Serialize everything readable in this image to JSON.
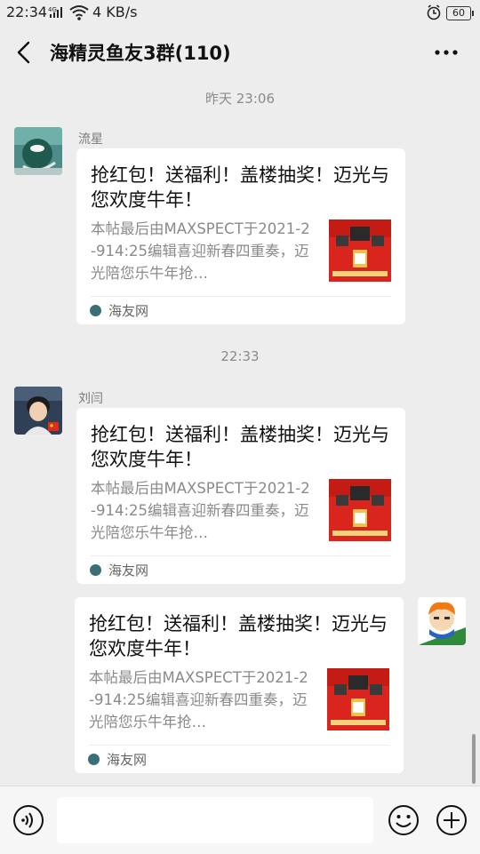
{
  "status_bar": {
    "time": "22:34",
    "signal_label": "4G",
    "speed": "4 KB/s",
    "battery": "60"
  },
  "header": {
    "title": "海精灵鱼友3群(110)"
  },
  "messages": [
    {
      "timestamp": "昨天 23:06",
      "sender": "流星",
      "card": {
        "title": "抢红包！送福利！盖楼抽奖！迈光与您欢度牛年！",
        "desc": "本帖最后由MAXSPECT于2021-2-914:25编辑喜迎新春四重奏，迈光陪您乐牛年抢…",
        "source": "海友网"
      }
    },
    {
      "timestamp": "22:33",
      "sender": "刘闫",
      "card": {
        "title": "抢红包！送福利！盖楼抽奖！迈光与您欢度牛年！",
        "desc": "本帖最后由MAXSPECT于2021-2-914:25编辑喜迎新春四重奏，迈光陪您乐牛年抢…",
        "source": "海友网"
      }
    },
    {
      "sender": "",
      "card": {
        "title": "抢红包！送福利！盖楼抽奖！迈光与您欢度牛年！",
        "desc": "本帖最后由MAXSPECT于2021-2-914:25编辑喜迎新春四重奏，迈光陪您乐牛年抢…",
        "source": "海友网"
      }
    }
  ],
  "input": {
    "value": ""
  },
  "icons": {
    "back": "back-arrow-icon",
    "more": "more-icon",
    "voice": "voice-icon",
    "emoji": "emoji-icon",
    "plus": "plus-icon"
  },
  "colors": {
    "background": "#ededed",
    "card": "#ffffff",
    "thumb_red": "#d9251d",
    "source_icon": "#3a6f77"
  }
}
